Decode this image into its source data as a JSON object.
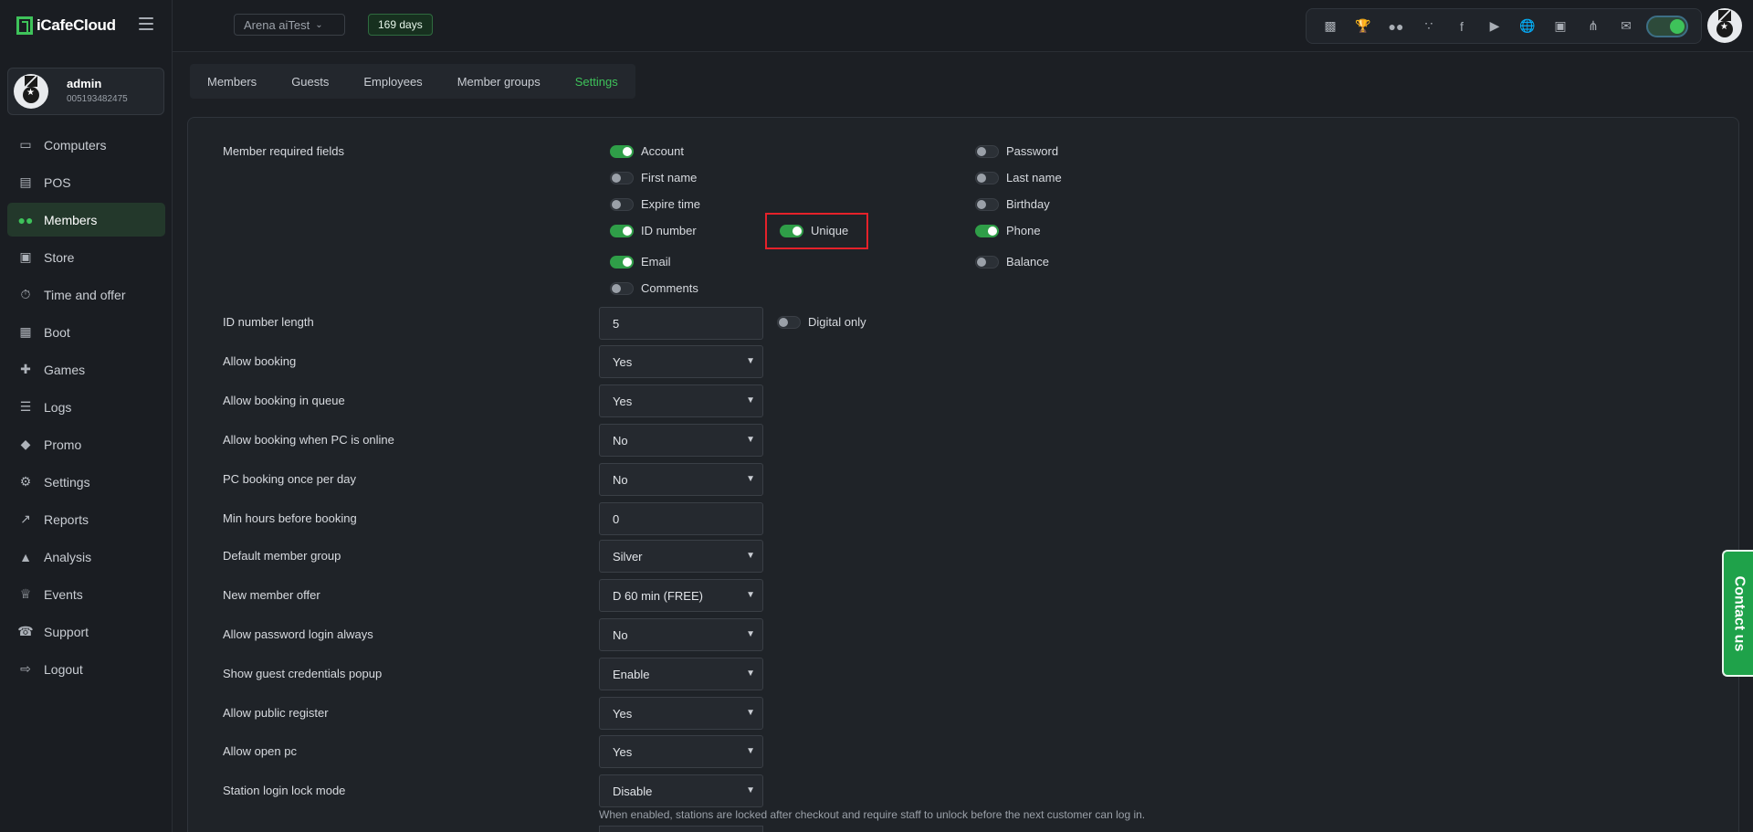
{
  "brand": {
    "name": "iCafeCloud"
  },
  "profile": {
    "name": "admin",
    "id": "005193482475"
  },
  "nav": [
    {
      "label": "Computers",
      "icon": "monitor-icon"
    },
    {
      "label": "POS",
      "icon": "pos-icon"
    },
    {
      "label": "Members",
      "icon": "users-icon",
      "active": true
    },
    {
      "label": "Store",
      "icon": "bag-icon"
    },
    {
      "label": "Time and offer",
      "icon": "stopwatch-icon"
    },
    {
      "label": "Boot",
      "icon": "windows-icon"
    },
    {
      "label": "Games",
      "icon": "gamepad-icon"
    },
    {
      "label": "Logs",
      "icon": "list-icon"
    },
    {
      "label": "Promo",
      "icon": "tag-icon"
    },
    {
      "label": "Settings",
      "icon": "gear-icon"
    },
    {
      "label": "Reports",
      "icon": "line-chart-icon"
    },
    {
      "label": "Analysis",
      "icon": "area-chart-icon"
    },
    {
      "label": "Events",
      "icon": "crown-icon"
    },
    {
      "label": "Support",
      "icon": "phone-icon"
    },
    {
      "label": "Logout",
      "icon": "logout-icon"
    }
  ],
  "topbar": {
    "workspace": "Arena aiTest",
    "days": "169 days",
    "icons": [
      "ranking-icon",
      "trophy-icon",
      "group-icon",
      "rss-icon",
      "facebook-icon",
      "youtube-icon",
      "globe-icon",
      "icafe-icon",
      "handshake-icon",
      "mail-icon"
    ]
  },
  "tabs": [
    "Members",
    "Guests",
    "Employees",
    "Member groups",
    "Settings"
  ],
  "active_tab": "Settings",
  "settings": {
    "required_label": "Member required fields",
    "toggles": {
      "account": {
        "label": "Account",
        "on": true
      },
      "password": {
        "label": "Password",
        "on": false
      },
      "first_name": {
        "label": "First name",
        "on": false
      },
      "last_name": {
        "label": "Last name",
        "on": false
      },
      "expire_time": {
        "label": "Expire time",
        "on": false
      },
      "birthday": {
        "label": "Birthday",
        "on": false
      },
      "id_number": {
        "label": "ID number",
        "on": true
      },
      "unique": {
        "label": "Unique",
        "on": true
      },
      "phone": {
        "label": "Phone",
        "on": true
      },
      "email": {
        "label": "Email",
        "on": true
      },
      "balance": {
        "label": "Balance",
        "on": false
      },
      "comments": {
        "label": "Comments",
        "on": false
      },
      "digital_only": {
        "label": "Digital only",
        "on": false
      }
    },
    "rows": [
      {
        "label": "ID number length",
        "value": "5",
        "type": "input"
      },
      {
        "label": "Allow booking",
        "value": "Yes",
        "type": "select"
      },
      {
        "label": "Allow booking in queue",
        "value": "Yes",
        "type": "select"
      },
      {
        "label": "Allow booking when PC is online",
        "value": "No",
        "type": "select"
      },
      {
        "label": "PC booking once per day",
        "value": "No",
        "type": "select"
      },
      {
        "label": "Min hours before booking",
        "value": "0",
        "type": "input"
      },
      {
        "label": "Default member group",
        "value": "Silver",
        "type": "select"
      },
      {
        "label": "New member offer",
        "value": "D 60 min (FREE)",
        "type": "select"
      },
      {
        "label": "Allow password login always",
        "value": "No",
        "type": "select"
      },
      {
        "label": "Show guest credentials popup",
        "value": "Enable",
        "type": "select"
      },
      {
        "label": "Allow public register",
        "value": "Yes",
        "type": "select"
      },
      {
        "label": "Allow open pc",
        "value": "Yes",
        "type": "select"
      },
      {
        "label": "Station login lock mode",
        "value": "Disable",
        "type": "select"
      }
    ],
    "lock_hint": "When enabled, stations are locked after checkout and require staff to unlock before the next customer can log in."
  },
  "contact": "Contact us",
  "colors": {
    "accent": "#3ec25a",
    "highlight": "#e5212a",
    "background": "#1c1f24"
  }
}
